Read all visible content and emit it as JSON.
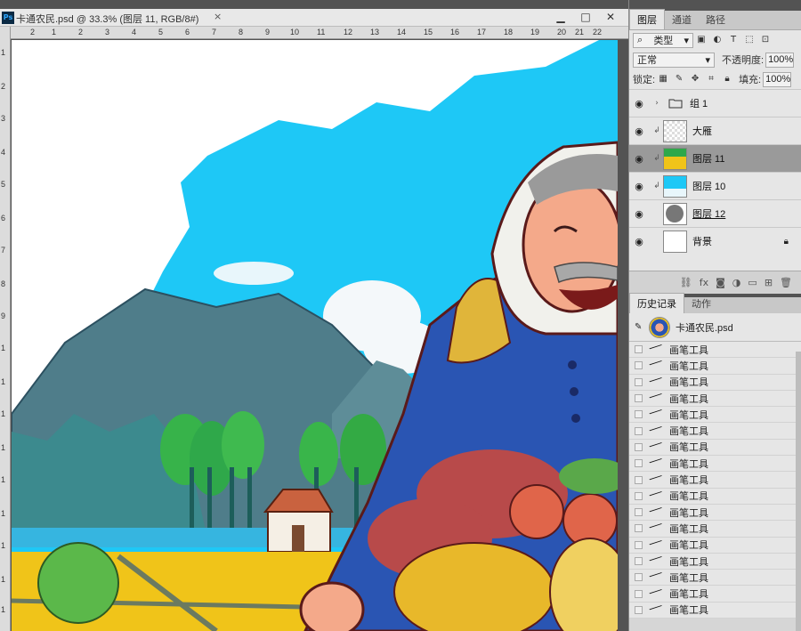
{
  "document": {
    "app_icon": "Ps",
    "tab_title": "卡通农民.psd @ 33.3% (图层 11, RGB/8#)",
    "tab_close": "×",
    "window_buttons": [
      "▁",
      "□",
      "✕"
    ],
    "ruler_top": [
      "2",
      "1",
      "2",
      "3",
      "4",
      "5",
      "6",
      "7",
      "8",
      "9",
      "10",
      "11",
      "12",
      "13",
      "14",
      "15",
      "16",
      "17",
      "18",
      "19",
      "20",
      "21",
      "22"
    ],
    "ruler_left": [
      "1",
      "2",
      "3",
      "4",
      "5",
      "6",
      "7",
      "8",
      "9",
      "1",
      "1",
      "1",
      "1",
      "1",
      "1",
      "1",
      "1",
      "1",
      "1"
    ]
  },
  "layers_panel": {
    "tabs": [
      "图层",
      "通道",
      "路径"
    ],
    "active_tab": "图层",
    "filter_label": "类型",
    "blend_mode": "正常",
    "opacity_label": "不透明度:",
    "opacity_value": "100%",
    "lock_label": "锁定:",
    "fill_label": "填充:",
    "fill_value": "100%",
    "layers": [
      {
        "name": "组 1",
        "type": "group",
        "selected": false
      },
      {
        "name": "大雁",
        "type": "smart",
        "selected": false
      },
      {
        "name": "图层 11",
        "type": "image",
        "selected": true
      },
      {
        "name": "图层 10",
        "type": "sky",
        "selected": false
      },
      {
        "name": "图层 12",
        "type": "gray",
        "selected": false
      },
      {
        "name": "背景",
        "type": "white",
        "selected": false
      }
    ]
  },
  "history_panel": {
    "tabs": [
      "历史记录",
      "动作"
    ],
    "active_tab": "历史记录",
    "snapshot_name": "卡通农民.psd",
    "items": [
      "画笔工具",
      "画笔工具",
      "画笔工具",
      "画笔工具",
      "画笔工具",
      "画笔工具",
      "画笔工具",
      "画笔工具",
      "画笔工具",
      "画笔工具",
      "画笔工具",
      "画笔工具",
      "画笔工具",
      "画笔工具",
      "画笔工具",
      "画笔工具",
      "画笔工具"
    ]
  },
  "colors": {
    "sky": "#1ec8f6",
    "mountain": "#4f7d8a",
    "jacket": "#2a55b3",
    "field": "#f0c419",
    "panel_bg": "#d6d6d6",
    "selected_layer": "#9a9a9a"
  }
}
